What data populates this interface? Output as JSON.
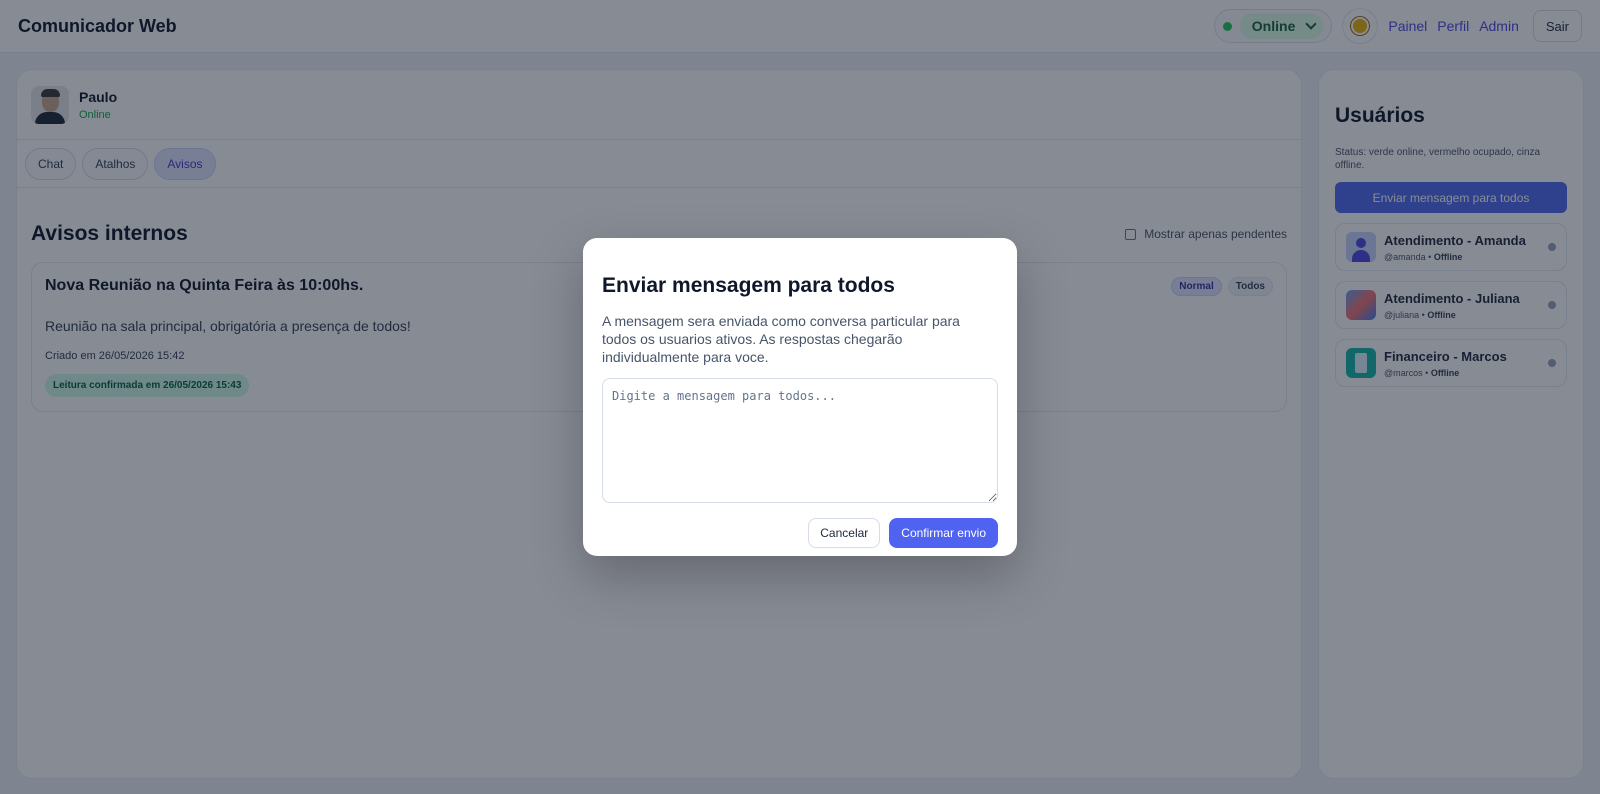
{
  "header": {
    "app_title": "Comunicador Web",
    "status_value": "Online",
    "nav": [
      "Painel",
      "Perfil",
      "Admin"
    ],
    "logout_label": "Sair"
  },
  "profile": {
    "name": "Paulo",
    "status": "Online"
  },
  "tabs": [
    {
      "label": "Chat"
    },
    {
      "label": "Atalhos"
    },
    {
      "label": "Avisos"
    }
  ],
  "notices": {
    "title": "Avisos internos",
    "filter_label": "Mostrar apenas pendentes",
    "items": [
      {
        "title": "Nova Reunião na Quinta Feira às 10:00hs.",
        "priority": "Normal",
        "audience": "Todos",
        "body": "Reunião na sala principal, obrigatória a presença de todos!",
        "created": "Criado em 26/05/2026 15:42",
        "confirmation": "Leitura confirmada em 26/05/2026 15:43"
      }
    ]
  },
  "users_panel": {
    "title": "Usuários",
    "note": "Status: verde online, vermelho ocupado, cinza offline.",
    "broadcast_label": "Enviar mensagem para todos",
    "users": [
      {
        "name": "Atendimento - Amanda",
        "handle": "@amanda",
        "status": "Offline"
      },
      {
        "name": "Atendimento - Juliana",
        "handle": "@juliana",
        "status": "Offline"
      },
      {
        "name": "Financeiro - Marcos",
        "handle": "@marcos",
        "status": "Offline"
      }
    ]
  },
  "modal": {
    "title": "Enviar mensagem para todos",
    "description": "A mensagem sera enviada como conversa particular para todos os usuarios ativos. As respostas chegarão individualmente para voce.",
    "placeholder": "Digite a mensagem para todos...",
    "value": "",
    "cancel_label": "Cancelar",
    "confirm_label": "Confirmar envio"
  },
  "colors": {
    "accent": "#4f62f0",
    "online": "#22c55e",
    "offline": "#94a3b8"
  },
  "icons": [
    "status-dot-icon",
    "chevron-down-icon",
    "sun-icon",
    "user-avatar-icon"
  ]
}
